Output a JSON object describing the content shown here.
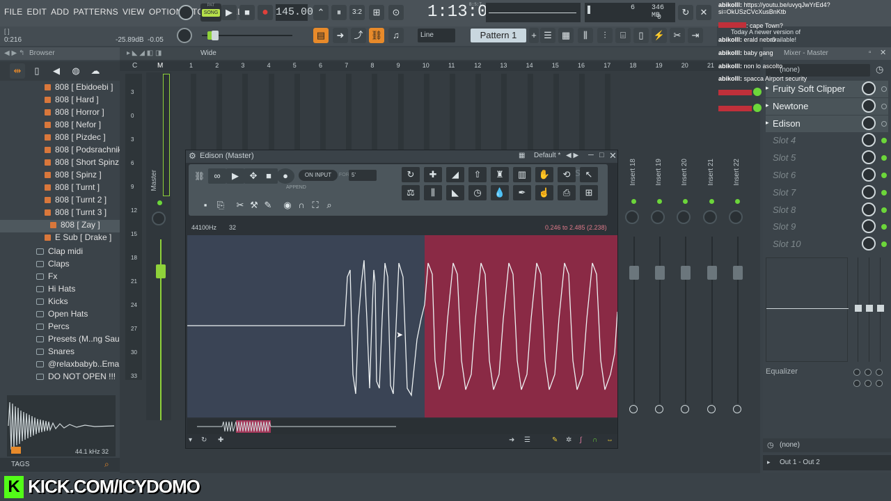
{
  "menu": [
    "FILE",
    "EDIT",
    "ADD",
    "PATTERNS",
    "VIEW",
    "OPTIONS",
    "TOOLS",
    "HELP"
  ],
  "transport": {
    "song_label": "SONG",
    "pat_label": "PAT",
    "tempo": "145.000",
    "time": "1:13:055",
    "time_sub": "B:S:T",
    "pattern": "Pattern 1",
    "snap": "Line",
    "mem": "346 MB",
    "cpu": "6",
    "poly": "0"
  },
  "hint": {
    "value": "0:216",
    "db": "-25.89dB",
    "pan": "-0.05"
  },
  "browser": {
    "title": "Browser",
    "stereo_label": "Wide",
    "items": [
      {
        "label": "808 [ Ebidoebi ]",
        "type": "file"
      },
      {
        "label": "808 [ Hard ]",
        "type": "file"
      },
      {
        "label": "808 [ Horror ]",
        "type": "file"
      },
      {
        "label": "808 [ Nefor ]",
        "type": "file"
      },
      {
        "label": "808 [ Pizdec ]",
        "type": "file"
      },
      {
        "label": "808 [ Podsrachnik ]",
        "type": "file"
      },
      {
        "label": "808 [ Short Spinz ]",
        "type": "file"
      },
      {
        "label": "808 [ Spinz ]",
        "type": "file"
      },
      {
        "label": "808 [ Turnt ]",
        "type": "file"
      },
      {
        "label": "808 [ Turnt 2 ]",
        "type": "file"
      },
      {
        "label": "808 [ Turnt 3 ]",
        "type": "file"
      },
      {
        "label": "808 [ Zay ]",
        "type": "file",
        "selected": true
      },
      {
        "label": "E Sub [ Drake ]",
        "type": "file"
      },
      {
        "label": "Clap midi",
        "type": "folder"
      },
      {
        "label": "Claps",
        "type": "folder"
      },
      {
        "label": "Fx",
        "type": "folder"
      },
      {
        "label": "Hi Hats",
        "type": "folder"
      },
      {
        "label": "Kicks",
        "type": "folder"
      },
      {
        "label": "Open Hats",
        "type": "folder"
      },
      {
        "label": "Percs",
        "type": "folder"
      },
      {
        "label": "Presets (M..ng Sauce)",
        "type": "folder"
      },
      {
        "label": "Snares",
        "type": "folder"
      },
      {
        "label": "@relaxbabyb..Email list",
        "type": "folder"
      },
      {
        "label": "DO NOT OPEN !!!",
        "type": "folder"
      }
    ],
    "sample_info": "44.1 kHz 32",
    "tags_label": "TAGS"
  },
  "mixer": {
    "master_label": "Master",
    "col_c": "C",
    "col_m": "M",
    "ruler": [
      "1",
      "2",
      "3",
      "4",
      "5",
      "6",
      "7",
      "8",
      "9",
      "10",
      "11",
      "12",
      "13",
      "14",
      "15",
      "16",
      "17",
      "18",
      "19",
      "20",
      "21"
    ],
    "inserts": [
      "Insert 18",
      "Insert 19",
      "Insert 20",
      "Insert 21",
      "Insert 22"
    ],
    "db_marks": [
      "3",
      "0",
      "3",
      "6",
      "9",
      "12",
      "15",
      "18",
      "21",
      "24",
      "27",
      "30",
      "33"
    ]
  },
  "edison": {
    "title": "Edison (Master)",
    "preset": "Default *",
    "on_input": "ON INPUT",
    "for_label": "FOR",
    "for_value": "5'",
    "append": "APPEND",
    "samplerate": "44100Hz",
    "format": "32",
    "selection": "0.246 to 2.485 (2.238)",
    "logo": "edison"
  },
  "channel": {
    "title": "Mixer - Master",
    "preset": "(none)",
    "slots": [
      "Fruity Soft Clipper",
      "Newtone",
      "Edison",
      "Slot 4",
      "Slot 5",
      "Slot 6",
      "Slot 7",
      "Slot 8",
      "Slot 9",
      "Slot 10"
    ],
    "eq_label": "Equalizer",
    "out_none": "(none)",
    "output": "Out 1 - Out 2"
  },
  "chat": [
    {
      "user": "abikolll:",
      "msg": "https://youtu.be/uvyqJwYrEd4?si=OkUSzCVcXusBnKtb"
    },
    {
      "user": "",
      "msg": ": cape Town?"
    },
    {
      "user": "abikolll:",
      "msg": "erald nebr0"
    },
    {
      "user": "abikolll:",
      "msg": "baby gang"
    },
    {
      "user": "abikolll:",
      "msg": "non lo ascolto"
    },
    {
      "user": "abikolll:",
      "msg": "spacca Airport security"
    }
  ],
  "notice": "Today  A newer version of",
  "notice2": "available!",
  "kick": "KICK.COM/ICYDOMO"
}
